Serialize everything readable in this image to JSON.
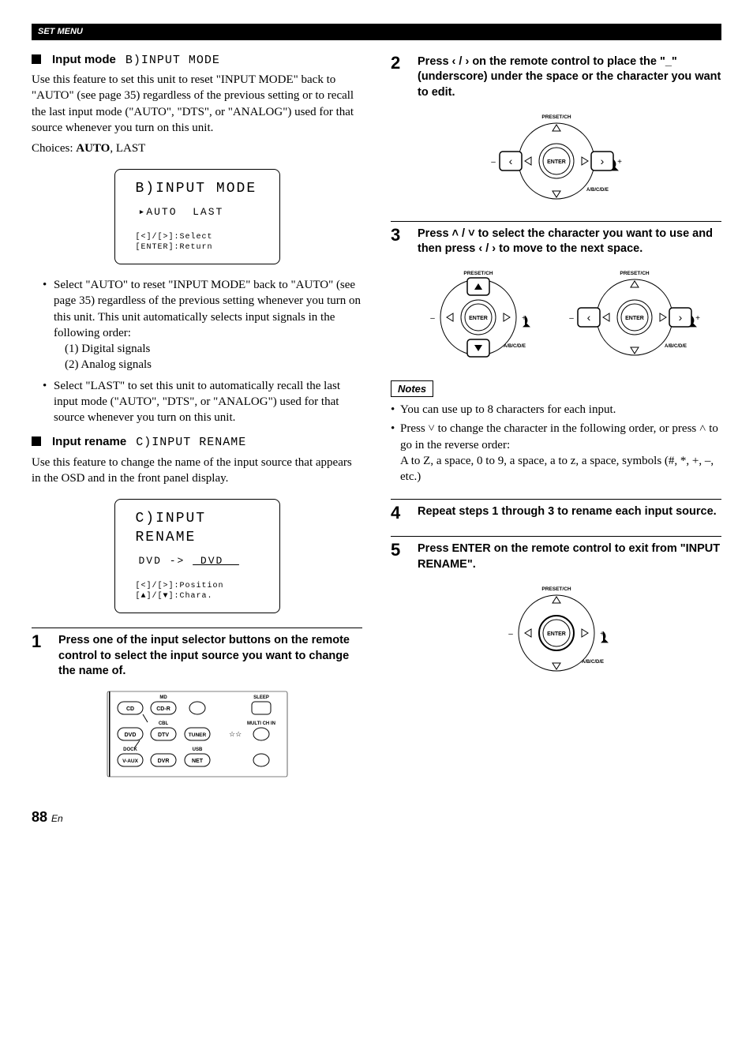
{
  "header": {
    "section": "SET MENU"
  },
  "left": {
    "inputMode": {
      "headLabel": "Input mode",
      "headOsd": "B)INPUT MODE",
      "desc": "Use this feature to set this unit to reset \"INPUT MODE\" back to \"AUTO\" (see page 35) regardless of the previous setting or to recall the last input mode (\"AUTO\", \"DTS\", or \"ANALOG\") used for that source whenever you turn on this unit.",
      "choicesLabel": "Choices: ",
      "choicesBold": "AUTO",
      "choicesRest": ", LAST",
      "osd": {
        "title": "B)INPUT MODE",
        "line1": "▸AUTO  LAST",
        "hints": "[<]/[>]:Select\n[ENTER]:Return"
      },
      "bullets": [
        "Select \"AUTO\" to reset \"INPUT MODE\" back to \"AUTO\" (see page 35) regardless of the previous setting whenever you turn on this unit. This unit automatically selects input signals in the following order:",
        "Select \"LAST\" to set this unit to automatically recall the last input mode (\"AUTO\", \"DTS\", or \"ANALOG\") used for that source whenever you turn on this unit."
      ],
      "orderLines": [
        "(1) Digital signals",
        "(2) Analog signals"
      ]
    },
    "inputRename": {
      "headLabel": "Input rename",
      "headOsd": "C)INPUT RENAME",
      "desc": "Use this feature to change the name of the input source that appears in the OSD and in the front panel display.",
      "osd": {
        "title": "C)INPUT RENAME",
        "line1": "DVD -> _DVD__",
        "hints": "[<]/[>]:Position\n[▲]/[▼]:Chara."
      }
    },
    "step1": {
      "num": "1",
      "text": "Press one of the input selector buttons on the remote control to select the input source you want to change the name of."
    },
    "remote": {
      "labels": {
        "md": "MD",
        "cbl": "CBL",
        "dock": "DOCK",
        "usb": "USB",
        "cd": "CD",
        "cdr": "CD-R",
        "dvd": "DVD",
        "dtv": "DTV",
        "tuner": "TUNER",
        "vaux": "V-AUX",
        "dvr": "DVR",
        "net": "NET",
        "sleep": "SLEEP",
        "multi": "MULTI CH IN"
      }
    }
  },
  "right": {
    "step2": {
      "num": "2",
      "text1": "Press ",
      "text2": " on the remote control to place the \"_\" (underscore) under the space or the character you want to edit.",
      "arrows": "‹ / ›"
    },
    "step3": {
      "num": "3",
      "text1": "Press ",
      "arrowsA": "˄ / ˅",
      "text2": " to select the character you want to use and then press ",
      "arrowsB": "‹ / ›",
      "text3": " to move to the next space."
    },
    "dpad": {
      "preset": "PRESET/CH",
      "enter": "ENTER",
      "abcde": "A/B/C/D/E",
      "minus": "–",
      "plus": "+"
    },
    "notesLabel": "Notes",
    "notes": {
      "note1": "You can use up to 8 characters for each input.",
      "note2a": "Press ",
      "note2b": " to change the character in the following order, or press ",
      "note2c": " to go in the reverse order:",
      "note2line2": "A to Z, a space, 0 to 9, a space, a to z, a space, symbols (#, *, +, –, etc.)",
      "down": "˅",
      "up": "˄"
    },
    "step4": {
      "num": "4",
      "text": "Repeat steps 1 through 3 to rename each input source."
    },
    "step5": {
      "num": "5",
      "text": "Press ENTER on the remote control to exit from \"INPUT RENAME\"."
    }
  },
  "footer": {
    "pageNum": "88",
    "lang": "En"
  }
}
